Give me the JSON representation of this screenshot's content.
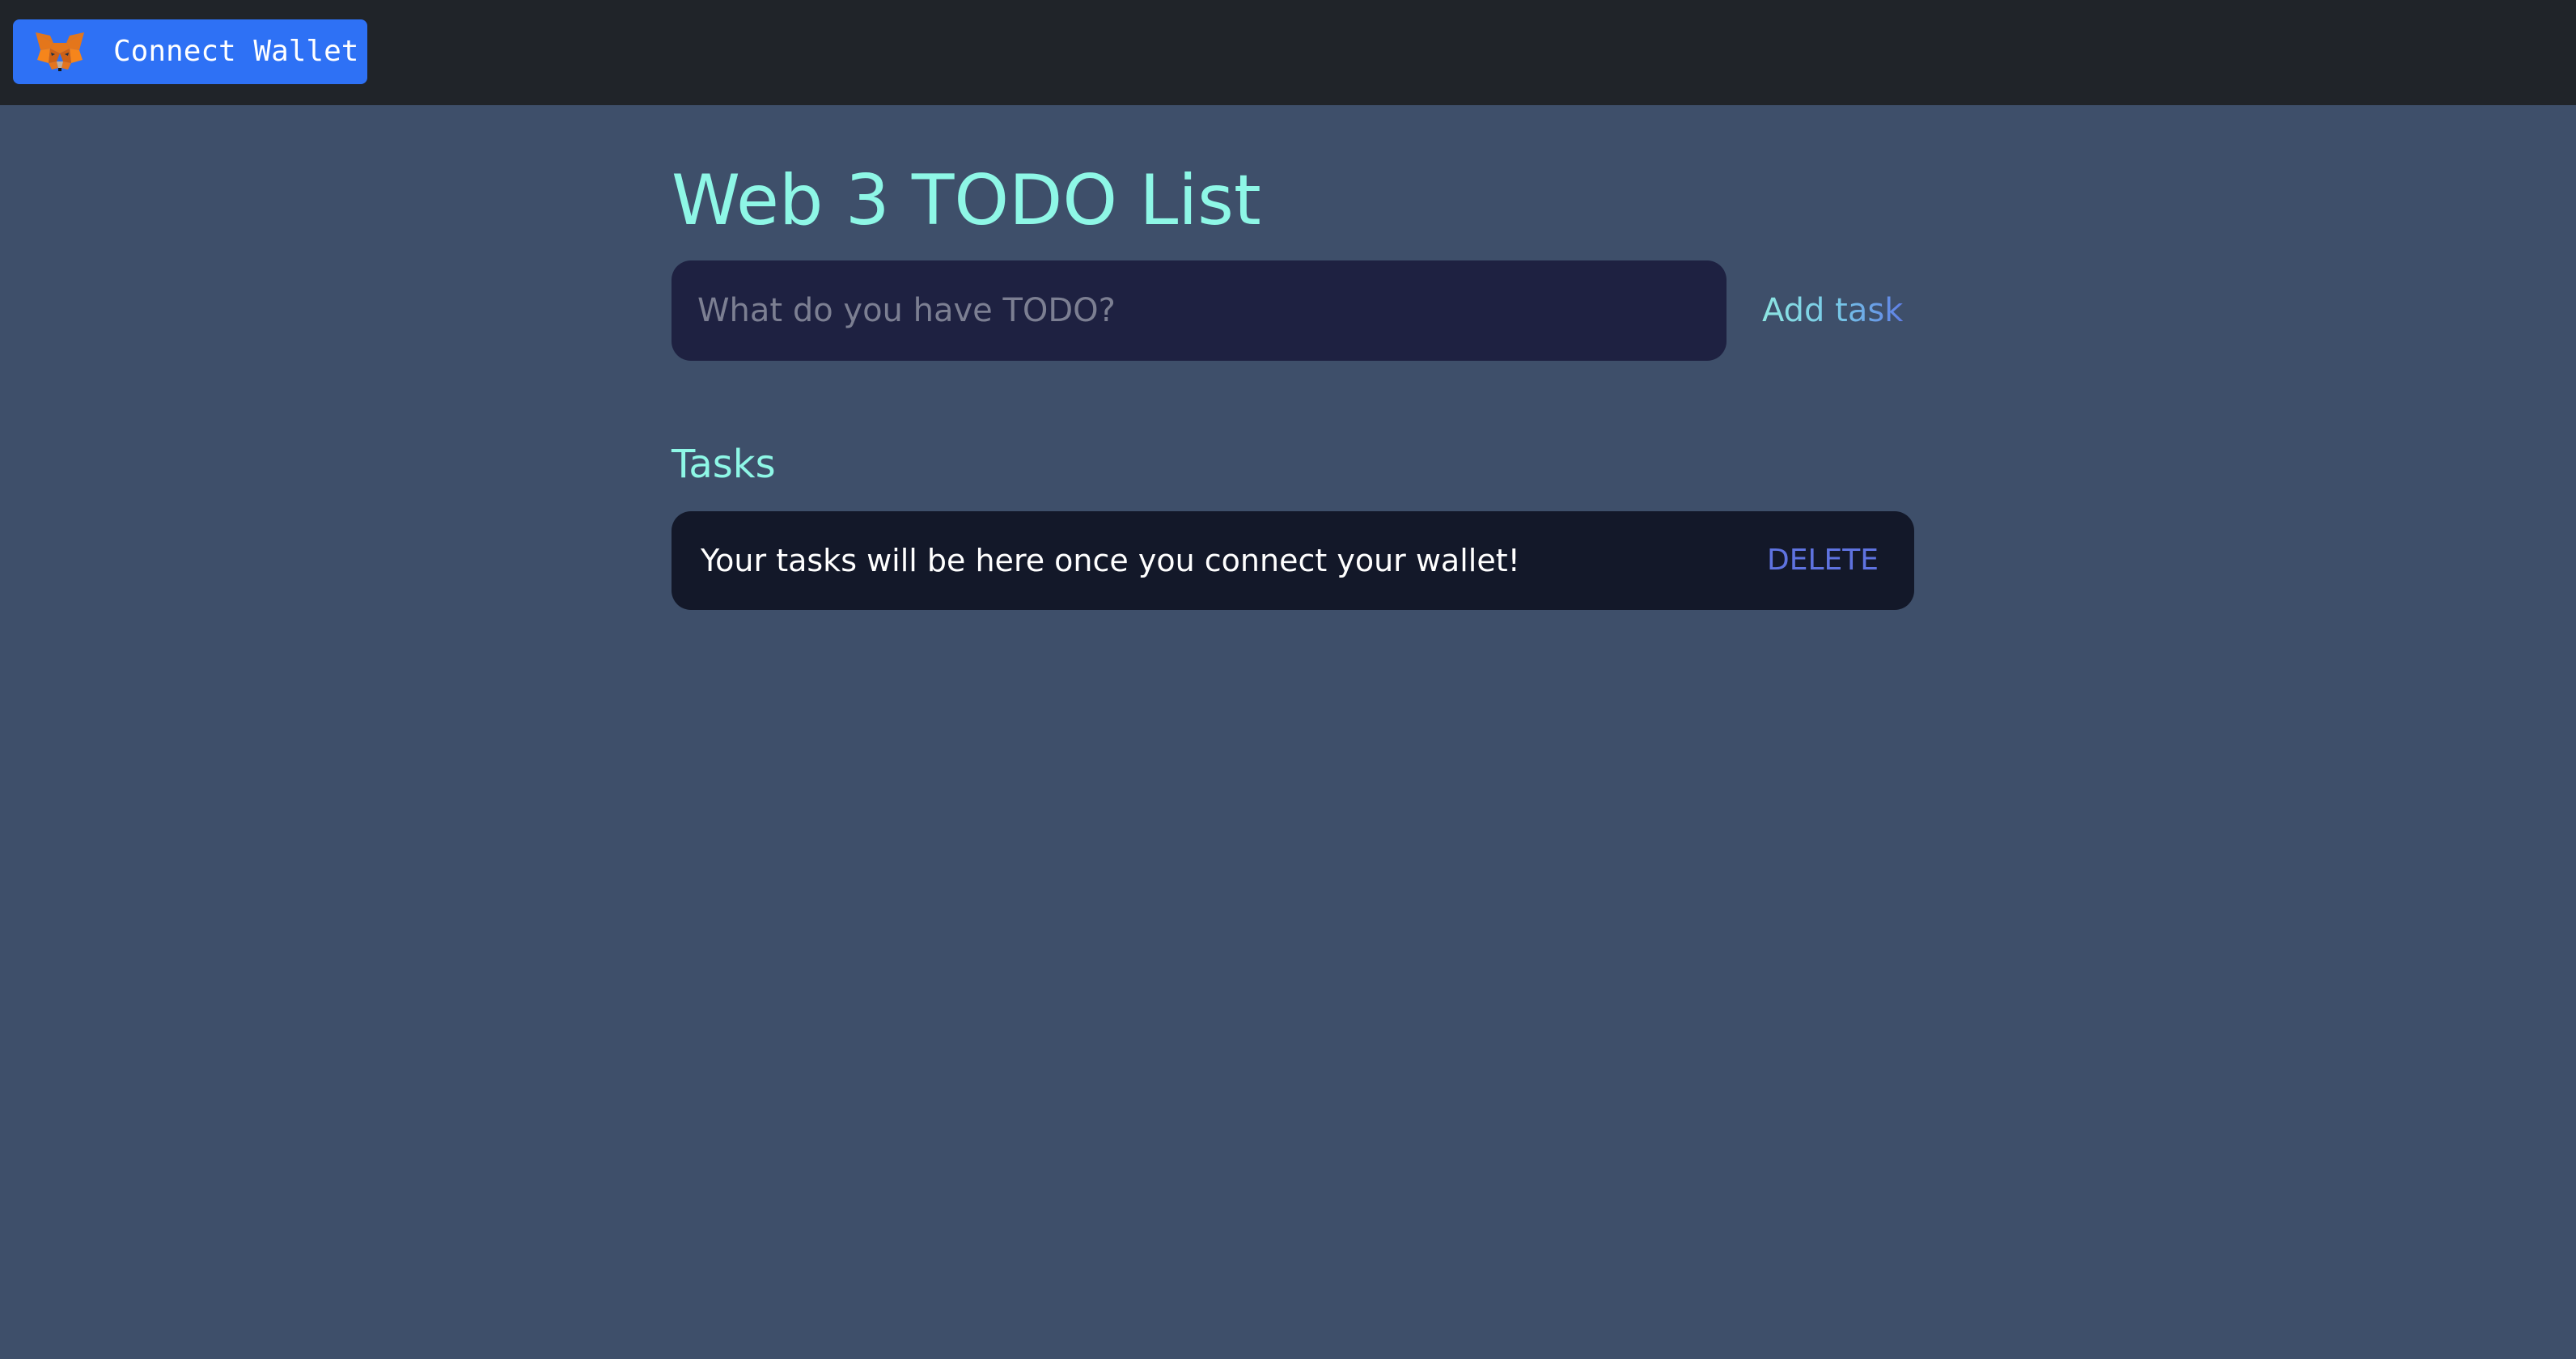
{
  "wallet": {
    "button_label": "Connect Wallet",
    "icon": "metamask-fox-icon"
  },
  "page": {
    "title": "Web 3 TODO List"
  },
  "task_form": {
    "input_value": "",
    "placeholder": "What do you have TODO?",
    "add_label": "Add task"
  },
  "tasks_section": {
    "heading": "Tasks",
    "items": [
      {
        "text": "Your tasks will be here once you connect your wallet!",
        "delete_label": "DELETE"
      }
    ]
  },
  "colors": {
    "background": "#3e4f6a",
    "topbar": "#202429",
    "wallet_button": "#2e71f5",
    "accent_teal": "#8ef7e6",
    "input_bg": "#1e2141",
    "task_bg": "#131829",
    "delete": "#5f73e0"
  }
}
